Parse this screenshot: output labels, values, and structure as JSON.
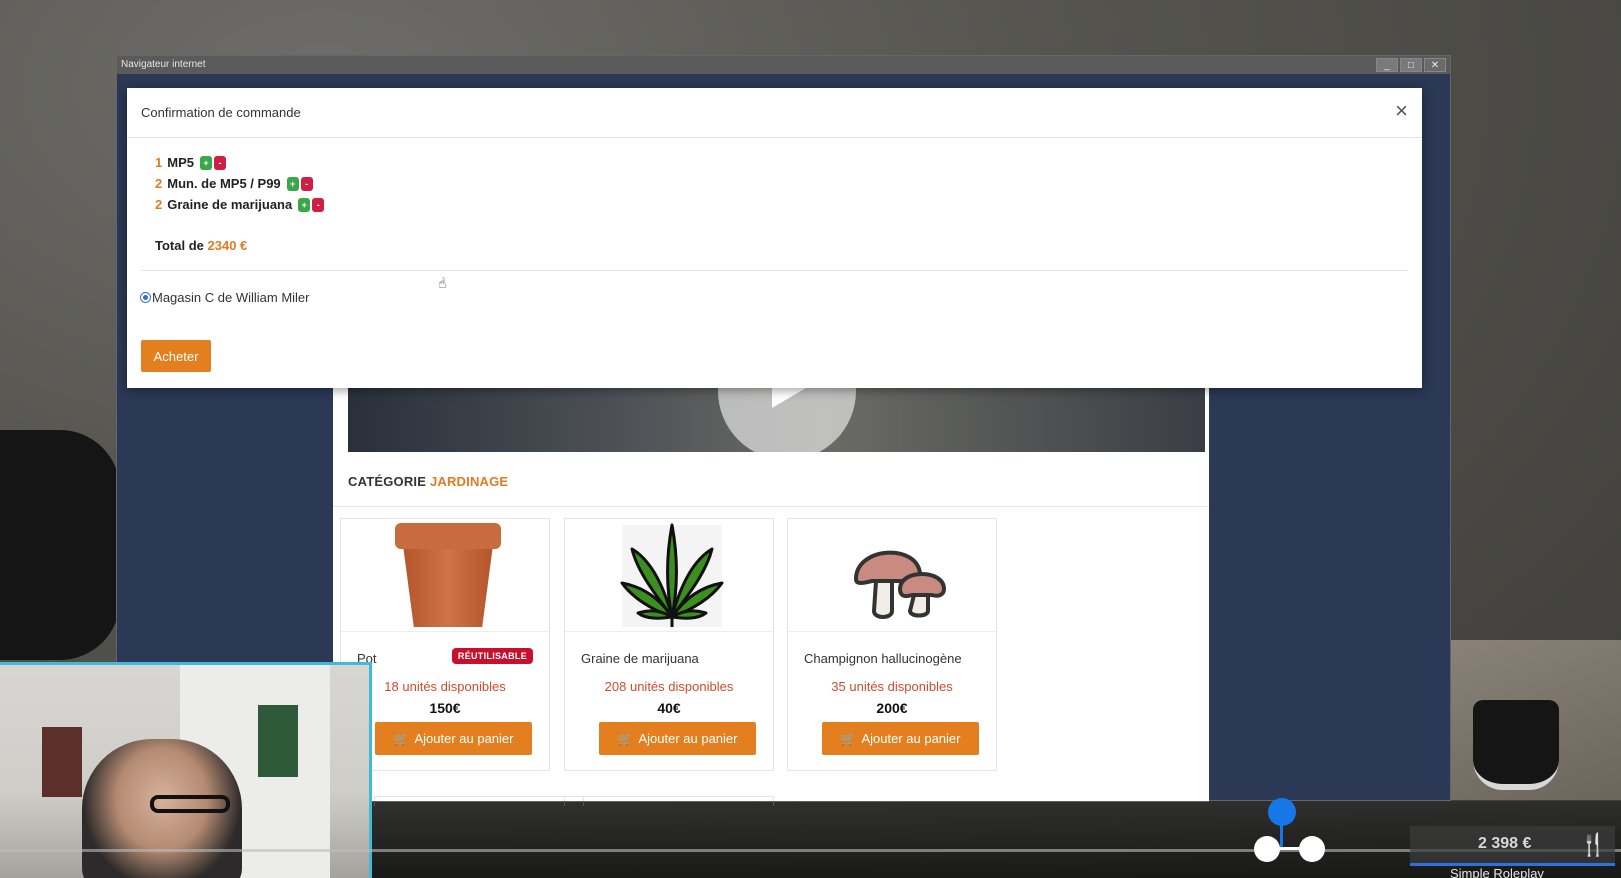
{
  "browser": {
    "title": "Navigateur internet",
    "min_label": "_",
    "max_label": "□",
    "close_label": "✕"
  },
  "page": {
    "category_prefix": "CATÉGORIE",
    "category_name": "JARDINAGE",
    "products": [
      {
        "name": "Pot",
        "badge": "RÉUTILISABLE",
        "stock": "18 unités disponibles",
        "price": "150€",
        "button": "Ajouter au panier",
        "icon": "flower-pot-icon"
      },
      {
        "name": "Graine de marijuana",
        "stock": "208 unités disponibles",
        "price": "40€",
        "button": "Ajouter au panier",
        "icon": "cannabis-leaf-icon"
      },
      {
        "name": "Champignon hallucinogène",
        "stock": "35 unités disponibles",
        "price": "200€",
        "button": "Ajouter au panier",
        "icon": "mushroom-icon"
      }
    ]
  },
  "modal": {
    "title": "Confirmation de commande",
    "close_label": "×",
    "items": [
      {
        "qty": "1",
        "name": "MP5",
        "plus": "+",
        "minus": "-"
      },
      {
        "qty": "2",
        "name": "Mun. de MP5 / P99",
        "plus": "+",
        "minus": "-"
      },
      {
        "qty": "2",
        "name": "Graine de marijuana",
        "plus": "+",
        "minus": "-"
      }
    ],
    "total_prefix": "Total de",
    "total_value": "2340 €",
    "store_option": "Magasin C de William Miler",
    "buy_label": "Acheter"
  },
  "hud": {
    "money": "2 398 €",
    "server": "Simple Roleplay"
  },
  "colors": {
    "accent": "#e47f1f",
    "plus": "#3aa84a",
    "minus": "#cf1f45",
    "badge": "#c8102e",
    "stock": "#d24b2a"
  }
}
